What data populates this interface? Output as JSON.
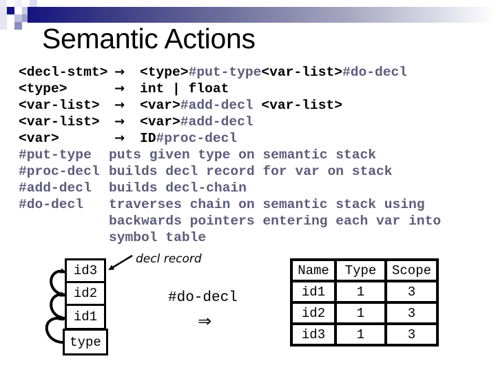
{
  "slide": {
    "title": "Semantic Actions",
    "colors": {
      "accent_navy": "#141480",
      "action_text": "#5c5c7c",
      "text": "#000000"
    }
  },
  "grammar": {
    "arrow_icon": "right-arrow",
    "rules": [
      {
        "lhs": "<decl-stmt>",
        "rhs": [
          {
            "t": "<type>",
            "k": "nt"
          },
          {
            "t": "#put-type",
            "k": "act"
          },
          {
            "t": "<var-list>",
            "k": "nt"
          },
          {
            "t": "#do-decl",
            "k": "act"
          }
        ]
      },
      {
        "lhs": "<type>",
        "rhs": [
          {
            "t": "int | float",
            "k": "nt"
          }
        ]
      },
      {
        "lhs": "<var-list>",
        "rhs": [
          {
            "t": "<var>",
            "k": "nt"
          },
          {
            "t": "#add-decl",
            "k": "act"
          },
          {
            "t": " <var-list>",
            "k": "nt"
          }
        ]
      },
      {
        "lhs": "<var-list>",
        "rhs": [
          {
            "t": "<var>",
            "k": "nt"
          },
          {
            "t": "#add-decl",
            "k": "act"
          }
        ]
      },
      {
        "lhs": "<var>",
        "rhs": [
          {
            "t": "ID",
            "k": "nt"
          },
          {
            "t": "#proc-decl",
            "k": "act"
          }
        ]
      }
    ]
  },
  "actions": [
    {
      "name": "#put-type",
      "lines": [
        "puts given type on semantic stack"
      ]
    },
    {
      "name": "#proc-decl",
      "lines": [
        "builds decl record for var on stack"
      ]
    },
    {
      "name": "#add-decl",
      "lines": [
        "builds decl-chain"
      ]
    },
    {
      "name": "#do-decl",
      "lines": [
        "traverses chain on semantic stack using",
        "backwards pointers entering each var into",
        "symbol table"
      ]
    }
  ],
  "stack": {
    "items": [
      "id3",
      "id2",
      "id1",
      "type"
    ],
    "pointer_label": "decl record"
  },
  "transition": {
    "label": "#do-decl",
    "arrow_icon": "double-right-arrow",
    "arrow_glyph": "⇒"
  },
  "symbol_table": {
    "headers": [
      "Name",
      "Type",
      "Scope"
    ],
    "rows": [
      [
        "id1",
        "1",
        "3"
      ],
      [
        "id2",
        "1",
        "3"
      ],
      [
        "id3",
        "1",
        "3"
      ]
    ]
  }
}
